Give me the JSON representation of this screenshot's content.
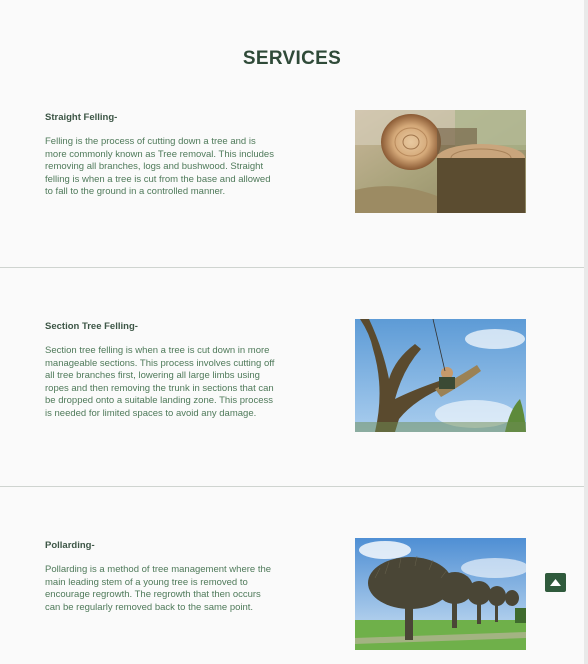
{
  "heading": "SERVICES",
  "services": [
    {
      "title": "Straight Felling-",
      "description": "Felling is the process of cutting down a tree and is more commonly known as Tree removal. This includes removing all branches, logs and bushwood. Straight felling is when a tree is cut from the base and allowed to fall to the ground in a controlled manner."
    },
    {
      "title": "Section Tree Felling-",
      "description": "Section tree felling is when a tree is cut down in more manageable sections. This process involves cutting off all tree branches first, lowering all large limbs using ropes and then removing the trunk in sections that can be dropped onto a suitable landing zone. This process is needed for limited spaces to avoid any damage."
    },
    {
      "title": "Pollarding-",
      "description": "Pollarding is a method of tree management where the main leading stem of a young tree is removed to encourage regrowth. The regrowth that then occurs can be regularly removed back to the same point."
    }
  ],
  "colors": {
    "heading": "#2f4a38",
    "title": "#3d5646",
    "body_text": "#4f7a5a",
    "back_to_top": "#2f5a3c"
  },
  "icons": {
    "back_to_top": "chevron-up-icon"
  }
}
